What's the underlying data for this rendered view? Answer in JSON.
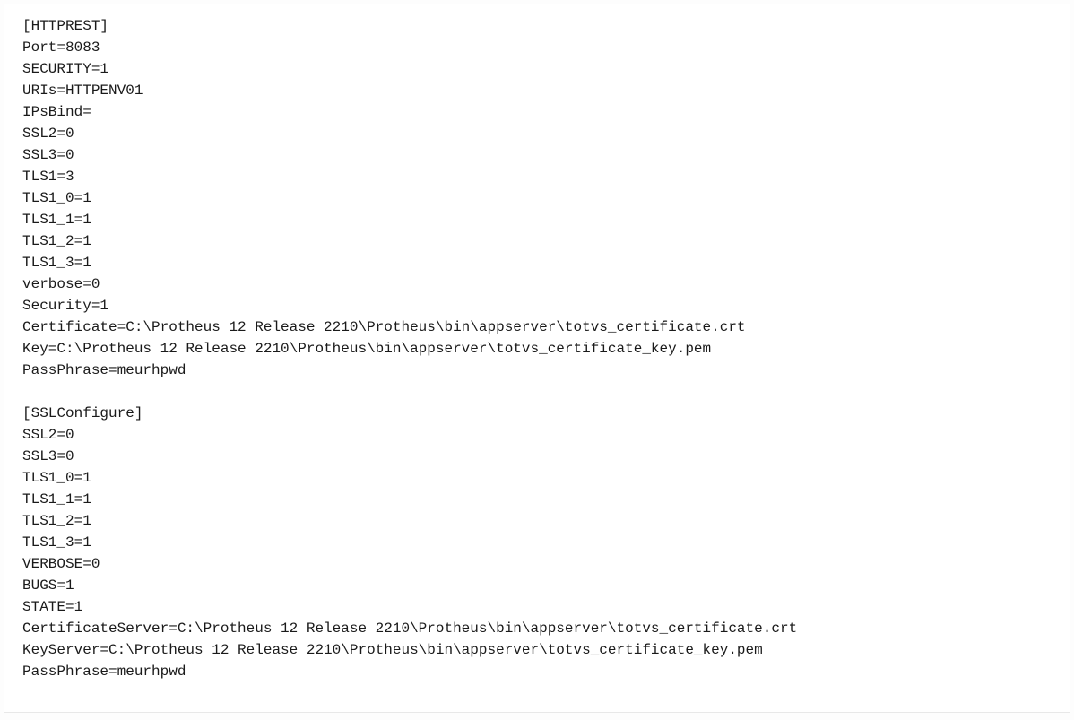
{
  "lines": [
    "[HTTPREST]",
    "Port=8083",
    "SECURITY=1",
    "URIs=HTTPENV01",
    "IPsBind=",
    "SSL2=0",
    "SSL3=0",
    "TLS1=3",
    "TLS1_0=1",
    "TLS1_1=1",
    "TLS1_2=1",
    "TLS1_3=1",
    "verbose=0",
    "Security=1",
    "Certificate=C:\\Protheus 12 Release 2210\\Protheus\\bin\\appserver\\totvs_certificate.crt",
    "Key=C:\\Protheus 12 Release 2210\\Protheus\\bin\\appserver\\totvs_certificate_key.pem",
    "PassPhrase=meurhpwd",
    "",
    "[SSLConfigure]",
    "SSL2=0",
    "SSL3=0",
    "TLS1_0=1",
    "TLS1_1=1",
    "TLS1_2=1",
    "TLS1_3=1",
    "VERBOSE=0",
    "BUGS=1",
    "STATE=1",
    "CertificateServer=C:\\Protheus 12 Release 2210\\Protheus\\bin\\appserver\\totvs_certificate.crt",
    "KeyServer=C:\\Protheus 12 Release 2210\\Protheus\\bin\\appserver\\totvs_certificate_key.pem",
    "PassPhrase=meurhpwd"
  ]
}
